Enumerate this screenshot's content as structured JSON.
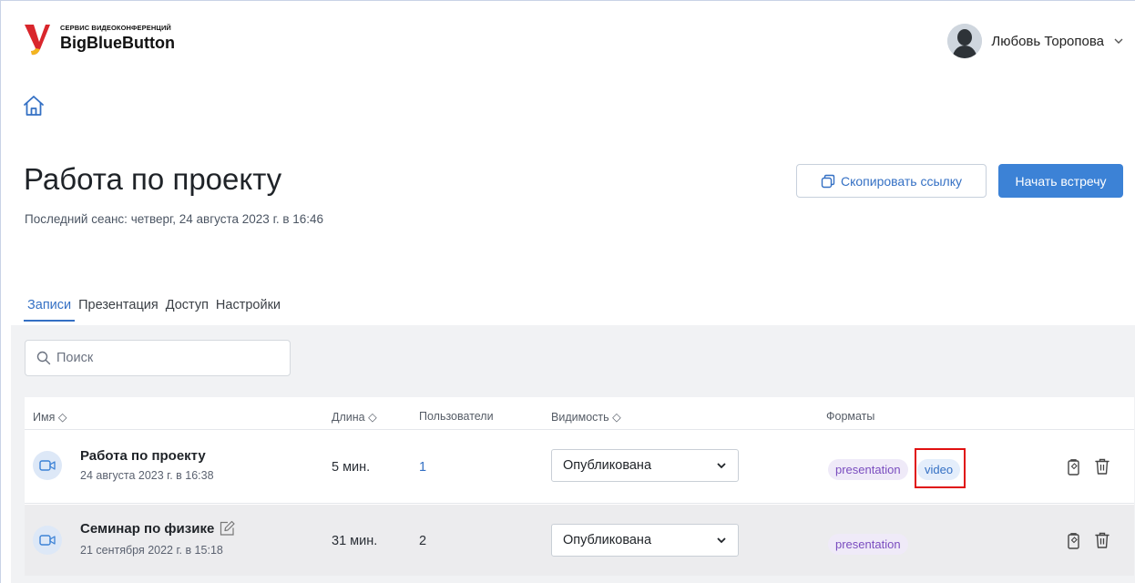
{
  "logo": {
    "small_text": "СЕРВИС ВИДЕОКОНФЕРЕНЦИЙ",
    "big_text": "BigBlueButton",
    "accent": "#d9262c",
    "accent2": "#f2b51f"
  },
  "user": {
    "name": "Любовь Торопова"
  },
  "room": {
    "title": "Работа по проекту",
    "last_session": "Последний сеанс: четверг, 24 августа 2023 г. в 16:46"
  },
  "buttons": {
    "copy_link": "Скопировать ссылку",
    "start_meeting": "Начать встречу"
  },
  "tabs": [
    {
      "label": "Записи",
      "active": true
    },
    {
      "label": "Презентация",
      "active": false
    },
    {
      "label": "Доступ",
      "active": false
    },
    {
      "label": "Настройки",
      "active": false
    }
  ],
  "search": {
    "placeholder": "Поиск"
  },
  "table": {
    "headers": {
      "name": "Имя ◇",
      "length": "Длина ◇",
      "users": "Пользователи",
      "visibility": "Видимость ◇",
      "formats": "Форматы"
    },
    "rows": [
      {
        "name": "Работа по проекту",
        "date": "24 августа 2023 г. в 16:38",
        "length": "5 мин.",
        "users": "1",
        "visibility": "Опубликована",
        "formats": [
          "presentation",
          "video"
        ]
      },
      {
        "name": "Семинар по физике",
        "date": "21 сентября 2022 г. в 15:18",
        "length": "31 мин.",
        "users": "2",
        "visibility": "Опубликована",
        "formats": [
          "presentation"
        ]
      }
    ]
  },
  "colors": {
    "primary": "#3c82d6",
    "link": "#3470c4",
    "highlight": "#e01010"
  }
}
